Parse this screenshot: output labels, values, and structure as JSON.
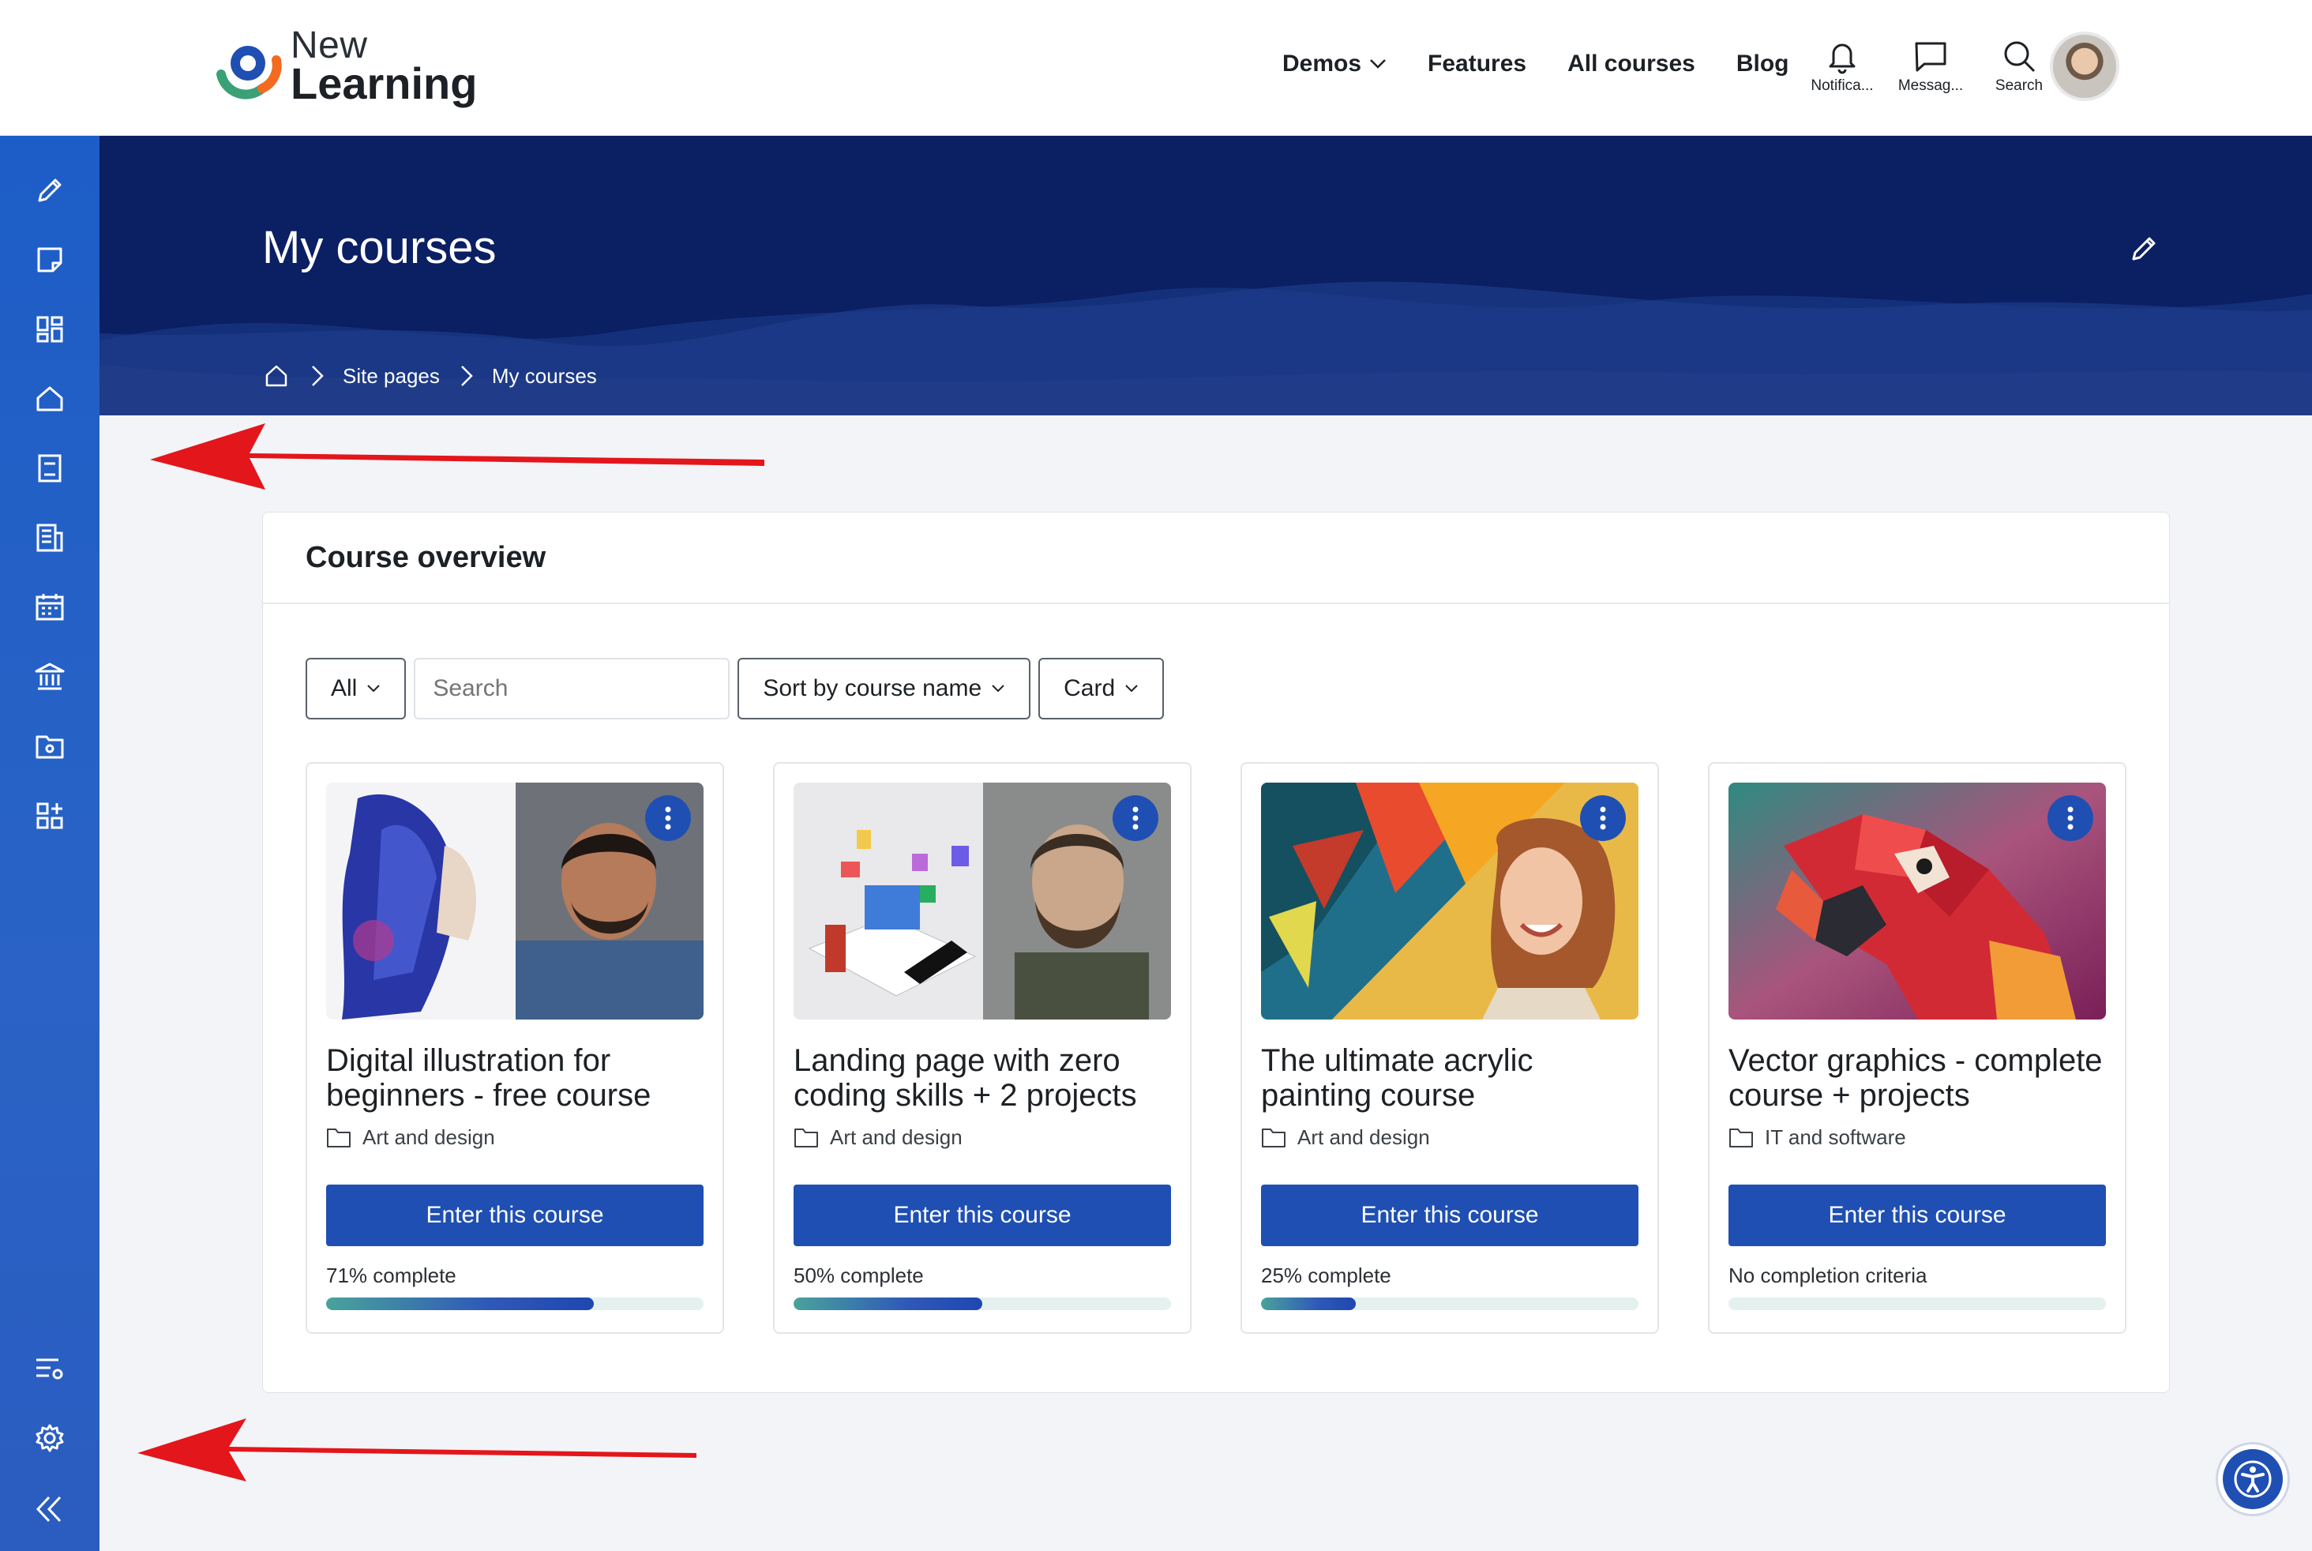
{
  "brand": {
    "line1": "New",
    "line2": "Learning"
  },
  "nav": {
    "links": [
      {
        "label": "Demos",
        "has_dropdown": true
      },
      {
        "label": "Features"
      },
      {
        "label": "All courses"
      },
      {
        "label": "Blog"
      }
    ],
    "icons": [
      {
        "icon": "bell-icon",
        "label": "Notifica..."
      },
      {
        "icon": "message-icon",
        "label": "Messag..."
      },
      {
        "icon": "search-icon",
        "label": "Search"
      }
    ]
  },
  "sidebar": {
    "icons": [
      "pencil-icon",
      "note-icon",
      "dashboard-icon",
      "home-icon",
      "book-icon",
      "news-icon",
      "calendar-icon",
      "institution-icon",
      "folder-settings-icon",
      "apps-icon",
      "list-settings-icon",
      "gear-icon",
      "collapse-icon"
    ]
  },
  "header": {
    "title": "My courses",
    "breadcrumb": [
      "Site pages",
      "My courses"
    ]
  },
  "overview": {
    "title": "Course overview",
    "filter_all": "All",
    "search_placeholder": "Search",
    "sort_label": "Sort by course name",
    "view_label": "Card"
  },
  "courses": [
    {
      "title_line1": "Digital illustration for",
      "title_line2": "beginners - free course",
      "category": "Art and design",
      "button": "Enter this course",
      "progress_label": "71% complete",
      "progress": 71
    },
    {
      "title_line1": "Landing page with zero",
      "title_line2": "coding skills + 2 projects",
      "category": "Art and design",
      "button": "Enter this course",
      "progress_label": "50% complete",
      "progress": 50
    },
    {
      "title_line1": "The ultimate acrylic",
      "title_line2": "painting course",
      "category": "Art and design",
      "button": "Enter this course",
      "progress_label": "25% complete",
      "progress": 25
    },
    {
      "title_line1": "Vector graphics - complete",
      "title_line2": "course + projects",
      "category": "IT and software",
      "button": "Enter this course",
      "progress_label": "No completion criteria",
      "progress": 0
    }
  ],
  "colors": {
    "primary": "#1f4fb2",
    "rail": "#1d5dc7",
    "hero": "#0b1f63",
    "annotation_arrow": "#e3161b"
  }
}
